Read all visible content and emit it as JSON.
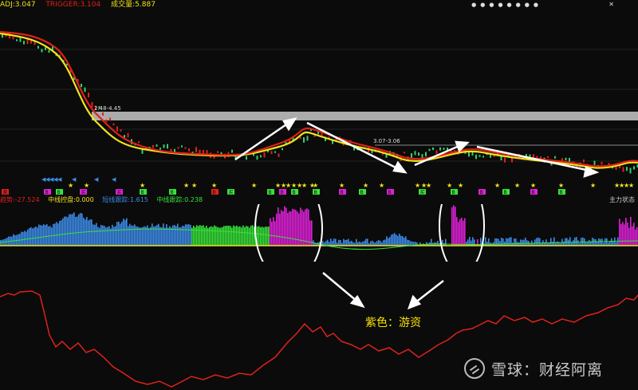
{
  "header": {
    "item1": "ADJ:3.047",
    "item2": "TRIGGER:3.104",
    "item3": "成交量:5.887"
  },
  "main_chart": {
    "price_labels": [
      "2.48-4.45",
      "3.07-3.06"
    ],
    "colors": {
      "ma_red": "#e0211b",
      "ma_yellow": "#f2e41c",
      "band": "#bdbdbd",
      "arrow": "#ffffff"
    }
  },
  "signal_row": {
    "tags": [
      "卖",
      "B",
      "B",
      "买",
      "买",
      "B",
      "B",
      "B",
      "买",
      "B",
      "B",
      "B",
      "B",
      "B",
      "B",
      "B",
      "买",
      "B",
      "B",
      "B",
      "B",
      "B"
    ]
  },
  "indicator": {
    "title": "主力状态",
    "fields": [
      {
        "text": "趋势:-27.524",
        "color": "#e0211b"
      },
      {
        "text": "中线控盘:0.000",
        "color": "#f2e41c"
      },
      {
        "text": "短线跟踪:1.615",
        "color": "#3d8be8"
      },
      {
        "text": "中线跟踪:0.238",
        "color": "#37e33a"
      }
    ],
    "colors": {
      "blue": "#3d8be8",
      "green": "#37e33a",
      "magenta": "#e020d8",
      "yellow": "#f2e41c"
    }
  },
  "annotation": {
    "label": "紫色：游资"
  },
  "watermark": {
    "text": "雪球：财经阿离"
  }
}
